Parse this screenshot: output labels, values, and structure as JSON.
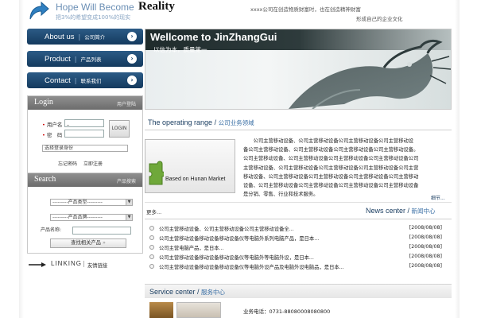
{
  "header": {
    "slogan_en": "Hope Will Become",
    "slogan_strong": "Reality",
    "slogan_cn": "把3%的希望变成100%的现实",
    "line1": "xxxx公司在创造物质财富时，也在创造精神财富",
    "line2": "形成自己的企业文化"
  },
  "nav": [
    {
      "en": "About us",
      "cn": "公司简介"
    },
    {
      "en": "Product",
      "cn": "产品列表"
    },
    {
      "en": "Contact",
      "cn": "联系我们"
    }
  ],
  "login": {
    "title": "Login",
    "subtitle": "用户登陆",
    "username_label": "用户名",
    "password_label": "密　码",
    "username_value": "_",
    "button": "LOGIN",
    "identity_select": "选择登录身份",
    "forgot": "忘记密码",
    "register": "立即注册"
  },
  "search": {
    "title": "Search",
    "subtitle": "产品搜索",
    "type_select": "---------产品类型---------",
    "brand_select": "---------产品品牌---------",
    "name_label": "产品名称:",
    "button": "查找相关产品"
  },
  "linking": {
    "en": "LINKING",
    "cn": "友情链接"
  },
  "banner": {
    "title": "Wellcome to JinZhangGui",
    "subtitle": "以信为本，质量第一"
  },
  "operating": {
    "title_en": "The operating range",
    "title_cn": "公司业务领域",
    "image_label": "Based on Hunan Market",
    "lines": [
      "　　公司主营移动设备、公司主营移动设备公司主营移动设备公司主营移动设",
      "备公司主营移动设备、公司主营移动设备公司主营移动设备公司主营移动设备。",
      "公司主营移动设备、公司主营移动设备公司主营移动设备公司主营移动设备公司",
      "主营移动设备、公司主营移动设备公司主营移动设备公司主营移动设备公司主营",
      "移动设备、公司主营移动设备公司主营移动设备公司主营移动设备公司主营移动",
      "设备、公司主营移动设备公司主营移动设备公司主营移动设备公司主营移动设备",
      "是分销、零售、行业和技术服务。"
    ],
    "detail": "细节..."
  },
  "news": {
    "more": "更多...",
    "title_en": "News center",
    "title_cn": "新闻中心",
    "items": [
      {
        "title": "公司主营移动设备、公司主营移动设备公司主营移动设备全...",
        "date": "[2008/08/08]"
      },
      {
        "title": "公司主营移动设备移动设备移动设备仪等电脑外系列电脑产品，是日本...",
        "date": "[2008/08/08]"
      },
      {
        "title": "公司主营电脑产品，是日本...",
        "date": "[2008/08/08]"
      },
      {
        "title": "公司主营移动设备移动设备移动设备仪等电脑外等电脑外设，是日本...",
        "date": "[2008/08/08]"
      },
      {
        "title": "公司主营移动设备移动设备移动设备仪等电脑外设产品及电脑外设电脑品，是日本...",
        "date": "[2008/08/08]"
      }
    ]
  },
  "service": {
    "title_en": "Service center",
    "title_cn": "服务中心",
    "phone_label": "业务电话：",
    "phone": "0731-88080008080800"
  }
}
